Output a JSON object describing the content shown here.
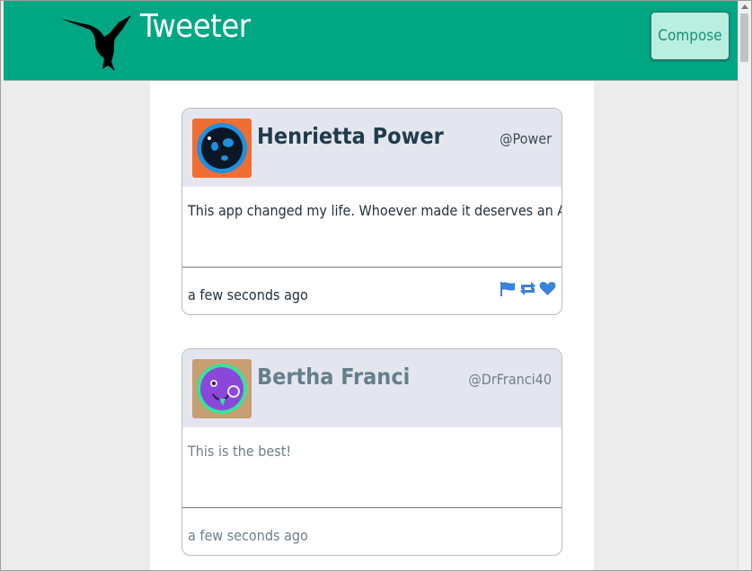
{
  "app": {
    "title": "Tweeter"
  },
  "nav": {
    "compose_label": "Compose"
  },
  "colors": {
    "navbar": "#00a783",
    "compose_bg": "#b8efe1",
    "action_icons": "#3b82d9"
  },
  "tweets": [
    {
      "name": "Henrietta Power",
      "handle": "@Power",
      "text": "This app changed my life. Whoever made it deserves an A+ !",
      "time": "a few seconds ago",
      "avatar_icon": "avatar-orange-circle-icon",
      "actions": [
        "flag-icon",
        "retweet-icon",
        "heart-icon"
      ]
    },
    {
      "name": "Bertha Franci",
      "handle": "@DrFranci40",
      "text": "This is the best!",
      "time": "a few seconds ago",
      "avatar_icon": "avatar-purple-face-icon"
    }
  ]
}
